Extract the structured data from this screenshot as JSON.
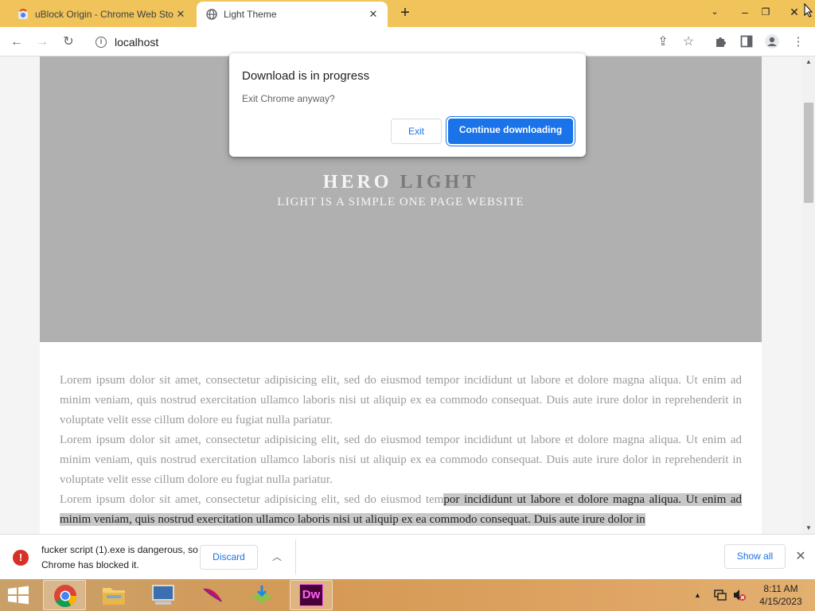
{
  "tabs": [
    {
      "title": "uBlock Origin - Chrome Web Sto",
      "active": false
    },
    {
      "title": "Light Theme",
      "active": true
    }
  ],
  "window_controls": {
    "minimize": "–",
    "restore": "❐",
    "close": "✕"
  },
  "toolbar": {
    "url": "localhost"
  },
  "page": {
    "hero_title_a": "HERO",
    "hero_title_b": "LIGHT",
    "hero_subtitle": "LIGHT IS A SIMPLE ONE PAGE WEBSITE",
    "paragraphs": [
      "Lorem ipsum dolor sit amet, consectetur adipisicing elit, sed do eiusmod tempor incididunt ut labore et dolore magna aliqua. Ut enim ad minim veniam, quis nostrud exercitation ullamco laboris nisi ut aliquip ex ea commodo consequat. Duis aute irure dolor in reprehenderit in voluptate velit esse cillum dolore eu fugiat nulla pariatur.",
      "Lorem ipsum dolor sit amet, consectetur adipisicing elit, sed do eiusmod tempor incididunt ut labore et dolore magna aliqua. Ut enim ad minim veniam, quis nostrud exercitation ullamco laboris nisi ut aliquip ex ea commodo consequat. Duis aute irure dolor in reprehenderit in voluptate velit esse cillum dolore eu fugiat nulla pariatur."
    ],
    "p3_plain": "Lorem ipsum dolor sit amet, consectetur adipisicing elit, sed do eiusmod tem",
    "p3_selected": "por incididunt ut labore et dolore magna aliqua. Ut enim ad minim veniam, quis nostrud exercitation ullamco laboris nisi ut aliquip ex ea commodo consequat. Duis aute irure dolor in"
  },
  "dialog": {
    "title": "Download is in progress",
    "message": "Exit Chrome anyway?",
    "exit_label": "Exit",
    "continue_label": "Continue downloading"
  },
  "download_shelf": {
    "warning": "fucker script (1).exe is dangerous, so Chrome has blocked it.",
    "discard_label": "Discard",
    "show_all_label": "Show all"
  },
  "taskbar": {
    "apps": [
      "chrome",
      "file-explorer",
      "remote-desktop",
      "feather-app",
      "download-installer",
      "dreamweaver"
    ],
    "dreamweaver_label": "Dw",
    "time": "8:11 AM",
    "date": "4/15/2023"
  },
  "colors": {
    "tabstrip": "#f0c35b",
    "accent": "#1a73e8",
    "danger": "#d93025",
    "hero": "#b0b0b0"
  }
}
